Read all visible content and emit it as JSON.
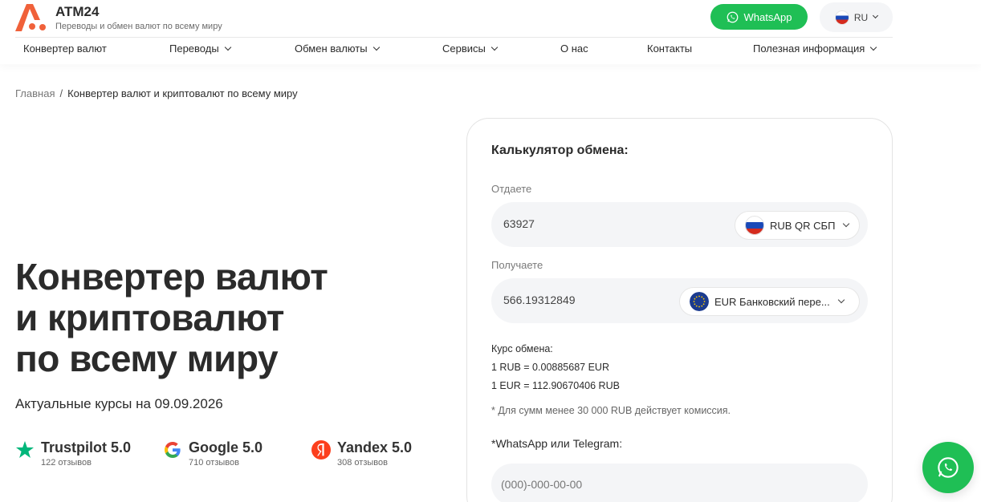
{
  "brand": {
    "name": "ATM24",
    "tagline": "Переводы и обмен валют по всему миру",
    "accent_color": "#f0613a"
  },
  "header": {
    "whatsapp_label": "WhatsApp",
    "language": "RU"
  },
  "nav": {
    "items": [
      {
        "label": "Конвертер валют",
        "has_dropdown": false
      },
      {
        "label": "Переводы",
        "has_dropdown": true
      },
      {
        "label": "Обмен валюты",
        "has_dropdown": true
      },
      {
        "label": "Сервисы",
        "has_dropdown": true
      },
      {
        "label": "О нас",
        "has_dropdown": false
      },
      {
        "label": "Контакты",
        "has_dropdown": false
      },
      {
        "label": "Полезная информация",
        "has_dropdown": true
      }
    ]
  },
  "breadcrumb": {
    "home": "Главная",
    "separator": "/",
    "current": "Конвертер валют и криптовалют по всему миру"
  },
  "hero": {
    "title_lines": [
      "Конвертер валют",
      "и криптовалют",
      "по всему миру"
    ],
    "rates_date": "Актуальные курсы на 09.09.2026"
  },
  "reviews": [
    {
      "name": "Trustpilot 5.0",
      "count": "122 отзывов",
      "icon": "trustpilot-star-icon",
      "color": "#00b67a"
    },
    {
      "name": "Google 5.0",
      "count": "710 отзывов",
      "icon": "google-icon",
      "color": "#4285f4"
    },
    {
      "name": "Yandex 5.0",
      "count": "308 отзывов",
      "icon": "yandex-icon",
      "color": "#fc3f1d"
    }
  ],
  "calculator": {
    "title": "Калькулятор обмена:",
    "give": {
      "label": "Отдаете",
      "amount": "63927",
      "currency": "RUB QR СБП"
    },
    "receive": {
      "label": "Получаете",
      "amount": "566.19312849",
      "currency": "EUR Банковский пере..."
    },
    "rate": {
      "title": "Курс обмена:",
      "line1": "1 RUB = 0.00885687 EUR",
      "line2": "1 EUR = 112.90670406 RUB"
    },
    "note": "* Для сумм менее 30 000 RUB действует комиссия.",
    "contact_label": "*WhatsApp или Telegram:",
    "phone_placeholder": "(000)-000-00-00"
  },
  "colors": {
    "whatsapp_green": "#1fbf55",
    "field_bg": "#f4f5f7"
  }
}
